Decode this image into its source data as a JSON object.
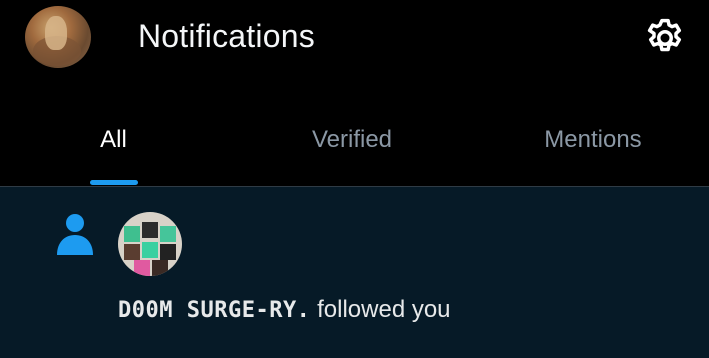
{
  "header": {
    "title": "Notifications",
    "settings_icon": "gear-icon",
    "avatar_icon": "profile-avatar"
  },
  "tabs": [
    {
      "label": "All",
      "active": true
    },
    {
      "label": "Verified",
      "active": false
    },
    {
      "label": "Mentions",
      "active": false
    }
  ],
  "colors": {
    "accent": "#1d9bf0",
    "background": "#000000",
    "unread_background": "#061a27",
    "inactive_tab": "#8b98a5"
  },
  "notifications": [
    {
      "type_icon": "person-icon",
      "user_name": "D00M SURGE-RY.",
      "action_text": " followed you"
    }
  ]
}
